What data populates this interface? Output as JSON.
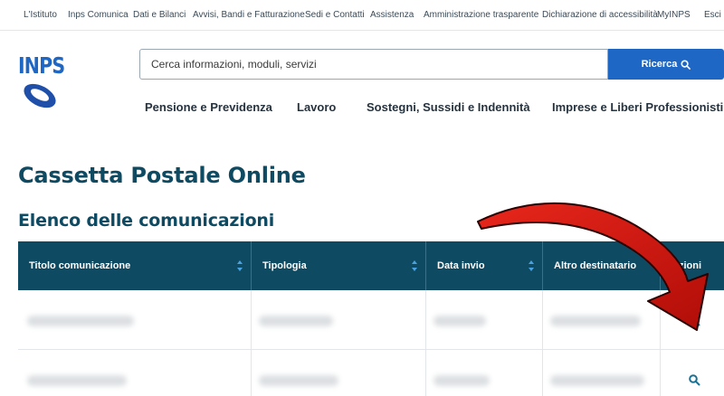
{
  "topbar": {
    "links": [
      "L'Istituto",
      "Inps Comunica",
      "Dati e Bilanci",
      "Avvisi, Bandi e Fatturazione",
      "Sedi e Contatti",
      "Assistenza",
      "Amministrazione trasparente",
      "Dichiarazione di accessibilità",
      "MyINPS",
      "Esci"
    ]
  },
  "logo": {
    "text": "INPS",
    "icon": "inps-ring-logo"
  },
  "search": {
    "placeholder": "Cerca informazioni, moduli, servizi",
    "button_label": "Ricerca",
    "button_icon": "search-icon"
  },
  "nav": {
    "items": [
      "Pensione e Previdenza",
      "Lavoro",
      "Sostegni, Sussidi e Indennità",
      "Imprese e Liberi Professionisti"
    ]
  },
  "page": {
    "title": "Cassetta Postale Online",
    "section_title": "Elenco delle comunicazioni"
  },
  "table": {
    "headers": [
      "Titolo comunicazione",
      "Tipologia",
      "Data invio",
      "Altro destinatario",
      "Azioni"
    ],
    "rows": [
      {
        "action_icon": "search-icon"
      },
      {
        "action_icon": "search-icon"
      }
    ]
  },
  "colors": {
    "primary": "#1f67c4",
    "header_bg": "#0f4a63",
    "title": "#0f4a63",
    "arrow": "#d4140f"
  }
}
